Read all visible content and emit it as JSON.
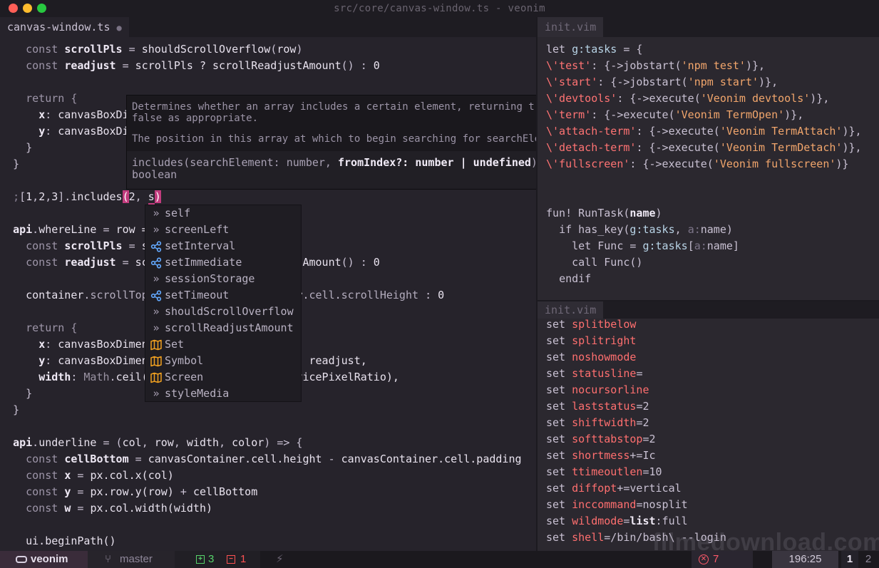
{
  "window": {
    "title": "src/core/canvas-window.ts - veonim",
    "traffic_lights": {
      "close": "#ff5f57",
      "minimize": "#febc2e",
      "zoom": "#28c840"
    }
  },
  "left_pane": {
    "tab": {
      "label": "canvas-window.ts",
      "modified_indicator": "●"
    }
  },
  "hover_doc": {
    "description": [
      "Determines whether an array includes a certain element, returning true or",
      "false as appropriate."
    ],
    "param_doc": "The position in this array at which to begin searching for searchElement.",
    "signature_prefix": "includes(searchElement: number, ",
    "signature_active_param": "fromIndex?: number | undefined",
    "signature_suffix": "):",
    "signature_return": "boolean"
  },
  "completion": {
    "items": [
      {
        "label": "self",
        "icon": "text-icon"
      },
      {
        "label": "screenLeft",
        "icon": "text-icon"
      },
      {
        "label": "setInterval",
        "icon": "method-icon"
      },
      {
        "label": "setImmediate",
        "icon": "method-icon"
      },
      {
        "label": "sessionStorage",
        "icon": "text-icon"
      },
      {
        "label": "setTimeout",
        "icon": "method-icon"
      },
      {
        "label": "shouldScrollOverflow",
        "icon": "text-icon"
      },
      {
        "label": "scrollReadjustAmount",
        "icon": "text-icon"
      },
      {
        "label": "Set",
        "icon": "class-icon"
      },
      {
        "label": "Symbol",
        "icon": "class-icon"
      },
      {
        "label": "Screen",
        "icon": "class-icon"
      },
      {
        "label": "styleMedia",
        "icon": "text-icon"
      }
    ]
  },
  "right_top": {
    "tab": {
      "label": "init.vim"
    }
  },
  "right_bottom": {
    "tab": {
      "label": "init.vim"
    }
  },
  "statusbar": {
    "project": "veonim",
    "branch": "master",
    "additions": "3",
    "deletions": "1",
    "errors": "7",
    "position": "196:25",
    "tabs": [
      "1",
      "2"
    ]
  },
  "watermark": "filmedownload.com"
}
